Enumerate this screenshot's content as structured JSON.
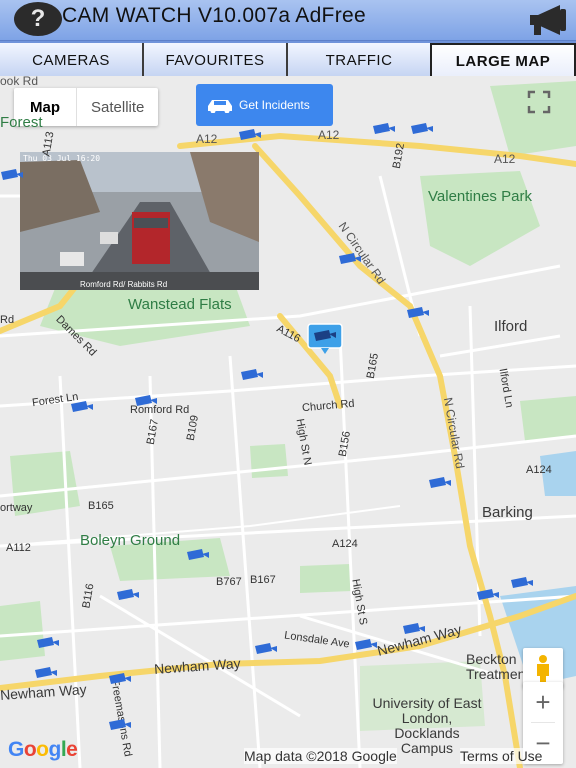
{
  "app": {
    "title": "CAM WATCH V10.007a AdFree",
    "help_label": "?"
  },
  "tabs": [
    {
      "label": "CAMERAS",
      "active": false
    },
    {
      "label": "FAVOURITES",
      "active": false
    },
    {
      "label": "TRAFFIC",
      "active": false
    },
    {
      "label": "LARGE MAP",
      "active": true
    }
  ],
  "map": {
    "type_options": [
      "Map",
      "Satellite"
    ],
    "selected_type": "Map",
    "incidents_label": "Get Incidents",
    "camera_feed": {
      "timestamp": "Thu 03 Jul 16:20",
      "caption": "Romford Rd/ Rabbits Rd"
    },
    "labels": {
      "places": [
        "Wanstead Flats",
        "Valentines Park",
        "Ilford",
        "Barking",
        "Boleyn Ground",
        "University of East London, Docklands Campus",
        "Beckton Treatment Wo"
      ],
      "roads": [
        "A12",
        "A12",
        "A12",
        "N Circular Rd",
        "N Circular Rd",
        "A116",
        "B165",
        "Forest Ln",
        "Romford Rd",
        "Church Rd",
        "High St N",
        "B167",
        "B109",
        "B165",
        "B767",
        "B167",
        "A124",
        "A124",
        "A112",
        "Newham Way",
        "Newham Way",
        "Newham Way",
        "Lonsdale Ave",
        "High St S",
        "B116",
        "Dames Rd",
        "B192",
        "A113",
        "B156",
        "Ilford Ln",
        "Rd",
        "Freemasons Rd"
      ],
      "edge": [
        "ook Rd",
        "Forest",
        "ortway"
      ]
    },
    "attribution": "Map data ©2018 Google",
    "terms": "Terms of Use",
    "logo": "Google",
    "zoom_in": "+",
    "zoom_out": "−"
  },
  "colors": {
    "title_bar": "#7ea3e6",
    "incidents_button": "#3d87ee",
    "camera_pin": "#2f6bd6",
    "road_major": "#f6d66a",
    "park": "#c8e6c2"
  }
}
